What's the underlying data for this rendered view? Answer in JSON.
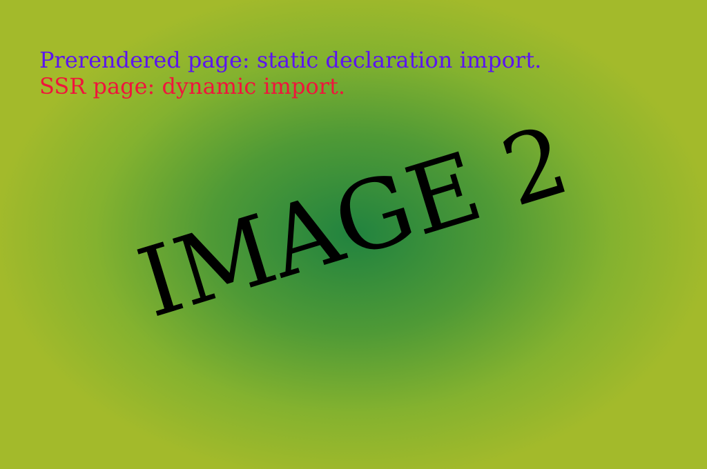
{
  "captions": {
    "prerendered": "Prerendered page: static declaration import.",
    "ssr": "SSR page: dynamic import."
  },
  "image_label": "IMAGE 2",
  "colors": {
    "prerendered_text": "#5b14f0",
    "ssr_text": "#f0143c",
    "label_text": "#000000",
    "background_center": "#21833f",
    "background_edge": "#a3ba2b"
  }
}
